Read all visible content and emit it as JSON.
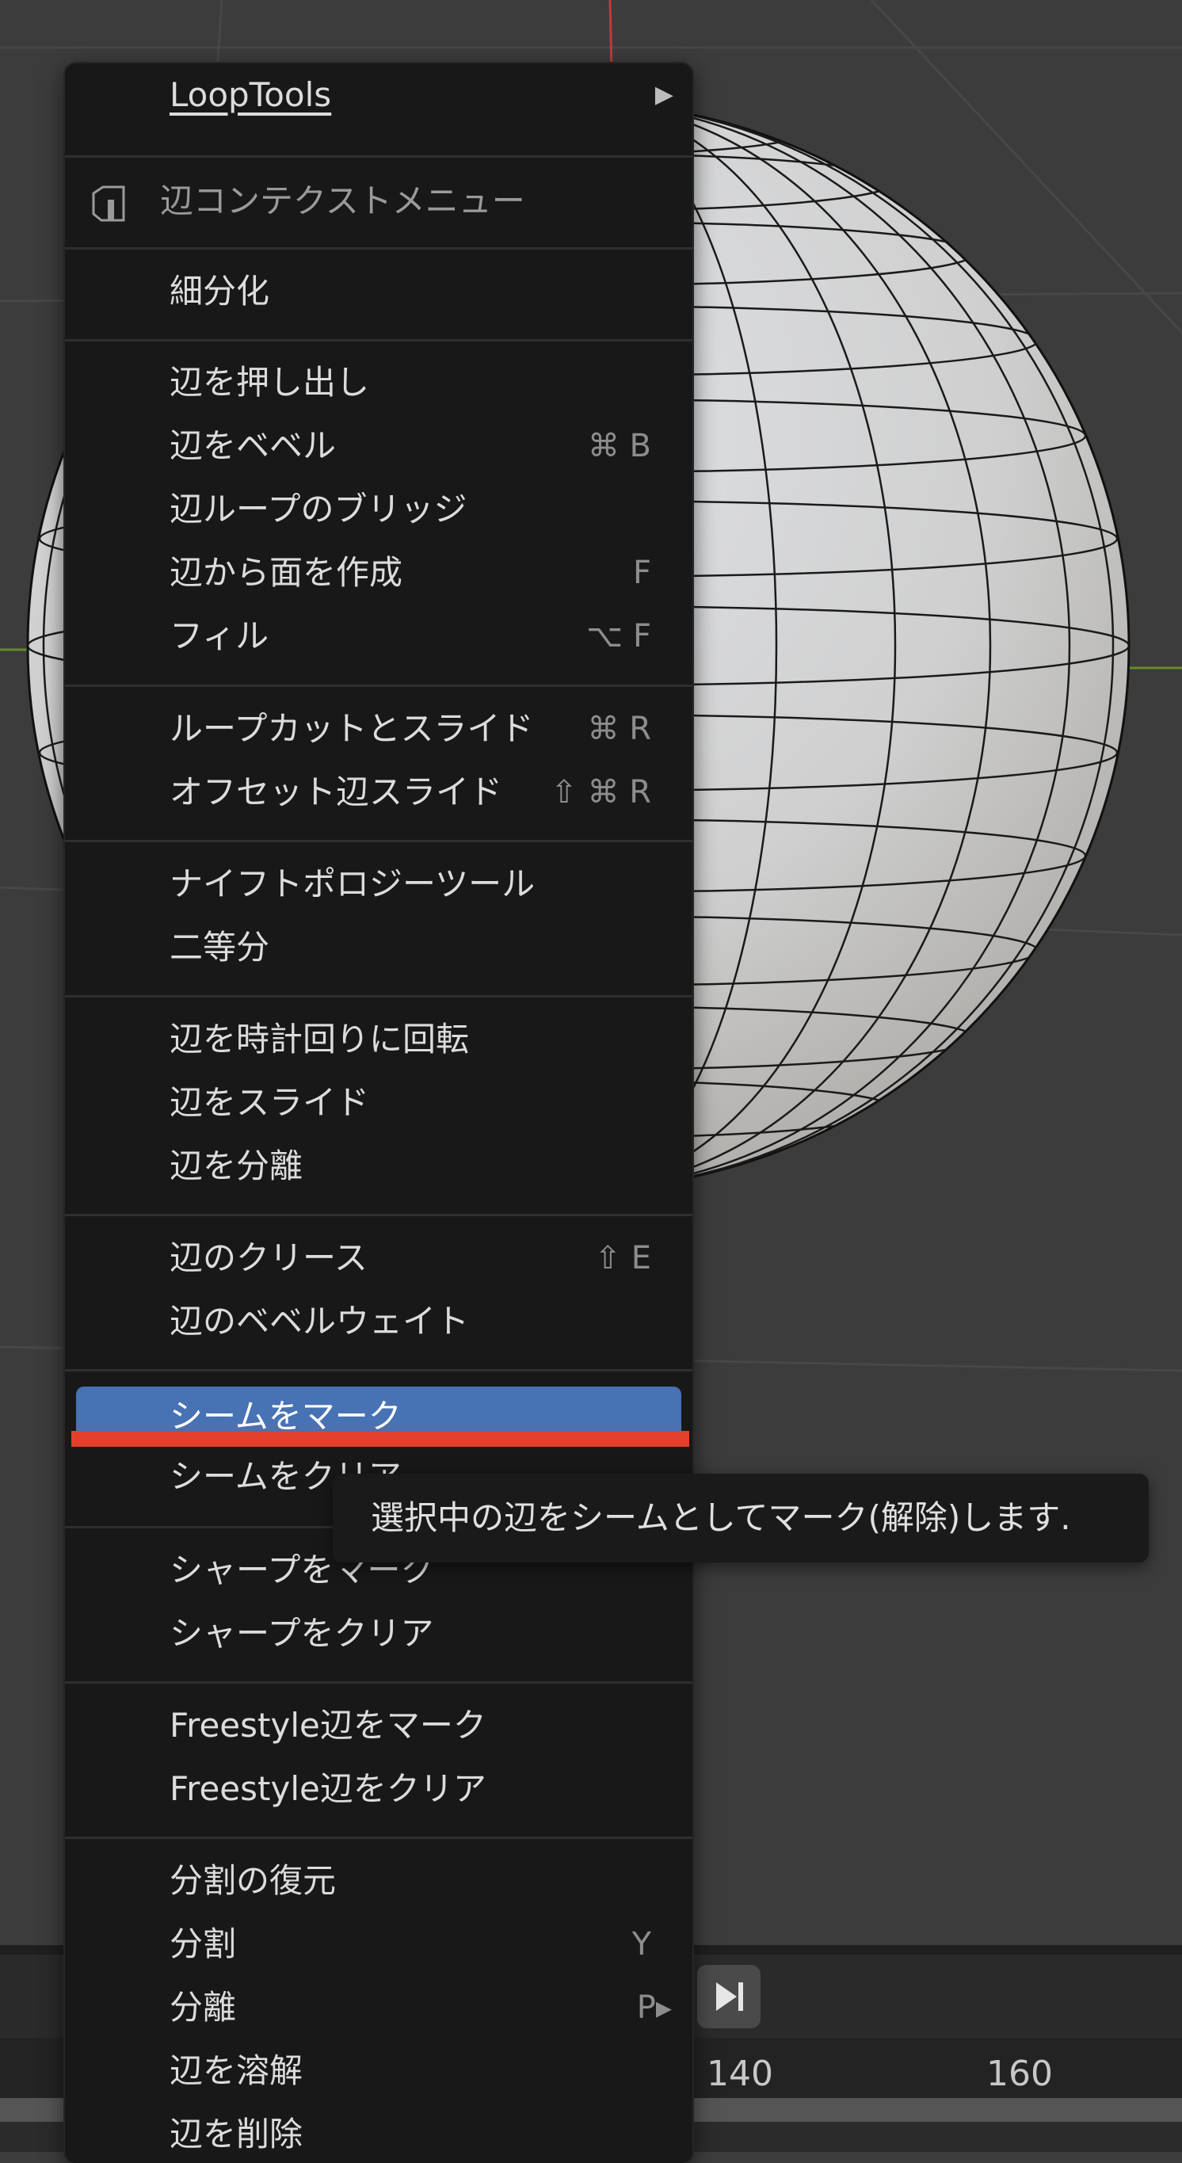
{
  "menu": {
    "items": [
      {
        "label": "LoopTools",
        "submenu": "▶"
      },
      {
        "label": "辺コンテクストメニュー",
        "icon": "edge-menu-icon"
      },
      {
        "label": "細分化"
      },
      {
        "label": "辺を押し出し"
      },
      {
        "label": "辺をベベル",
        "shortcut": "⌘ B"
      },
      {
        "label": "辺ループのブリッジ"
      },
      {
        "label": "辺から面を作成",
        "shortcut": "F"
      },
      {
        "label": "フィル",
        "shortcut": "⌥ F"
      },
      {
        "label": "ループカットとスライド",
        "shortcut": "⌘ R"
      },
      {
        "label": "オフセット辺スライド",
        "shortcut": "⇧ ⌘ R"
      },
      {
        "label": "ナイフトポロジーツール"
      },
      {
        "label": "二等分"
      },
      {
        "label": "辺を時計回りに回転"
      },
      {
        "label": "辺をスライド"
      },
      {
        "label": "辺を分離"
      },
      {
        "label": "辺のクリース",
        "shortcut": "⇧ E"
      },
      {
        "label": "辺のベベルウェイト"
      },
      {
        "label": "シームをマーク"
      },
      {
        "label": "シームをクリア"
      },
      {
        "label": "シャープをマーク"
      },
      {
        "label": "シャープをクリア"
      },
      {
        "label": "Freestyle辺をマーク"
      },
      {
        "label": "Freestyle辺をクリア"
      },
      {
        "label": "分割の復元"
      },
      {
        "label": "分割",
        "shortcut": "Y"
      },
      {
        "label": "分離",
        "shortcut": "P▸"
      },
      {
        "label": "辺を溶解"
      },
      {
        "label": "辺を削除"
      }
    ]
  },
  "tooltip": {
    "text": "選択中の辺をシームとしてマーク(解除)します."
  },
  "timeline": {
    "frames": [
      "140",
      "160"
    ]
  },
  "colors": {
    "highlight": "#4772b3",
    "annotation": "#e2402a"
  }
}
